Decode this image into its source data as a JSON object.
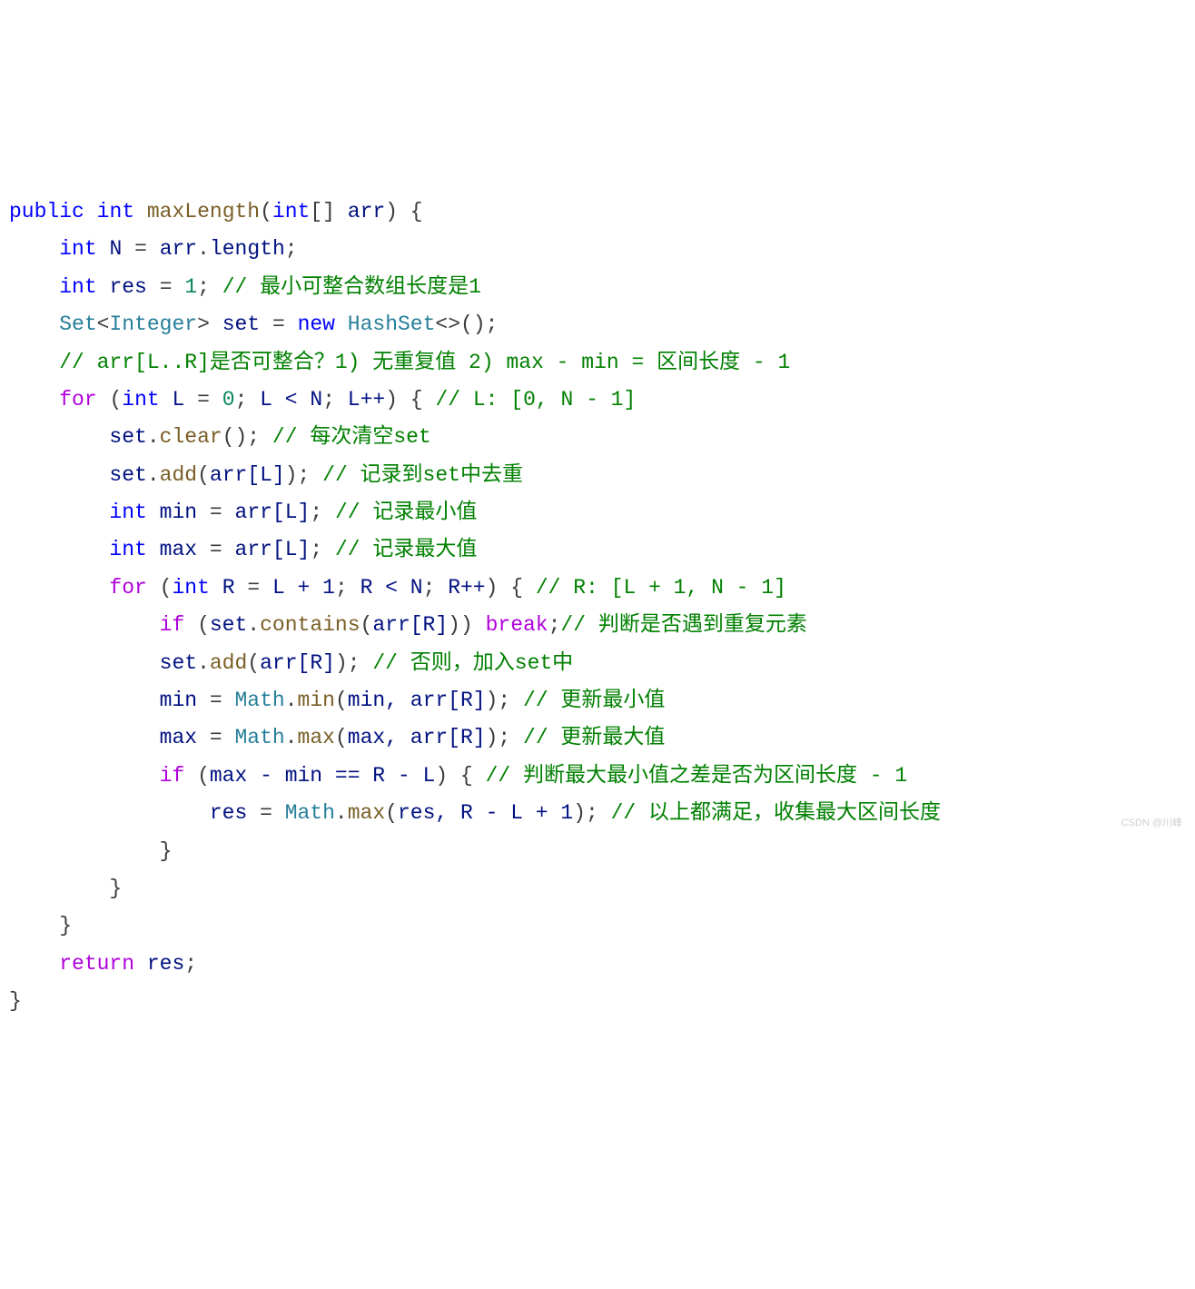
{
  "lines": {
    "l1": {
      "kw1": "public",
      "kw2": "int",
      "fn": "maxLength",
      "kw3": "int",
      "param": "arr"
    },
    "l2": {
      "kw": "int",
      "v": "N",
      "rhs_v": "arr",
      "rhs_f": "length"
    },
    "l3": {
      "kw": "int",
      "v": "res",
      "num": "1",
      "cmt": "// 最小可整合数组长度是1"
    },
    "l4": {
      "t1": "Set",
      "t2": "Integer",
      "v": "set",
      "kw": "new",
      "t3": "HashSet"
    },
    "l5": {
      "cmt": "// arr[L..R]是否可整合？1) 无重复值 2) max - min = 区间长度 - 1"
    },
    "l6": {
      "ctrl": "for",
      "kw": "int",
      "v": "L",
      "n0": "0",
      "cond": "L < N",
      "inc": "L++",
      "cmt": "// L: [0, N - 1]"
    },
    "l7": {
      "obj": "set",
      "m": "clear",
      "cmt": "// 每次清空set"
    },
    "l8": {
      "obj": "set",
      "m": "add",
      "arg": "arr[L]",
      "cmt": "// 记录到set中去重"
    },
    "l9": {
      "kw": "int",
      "v": "min",
      "rhs": "arr[L]",
      "cmt": "// 记录最小值"
    },
    "l10": {
      "kw": "int",
      "v": "max",
      "rhs": "arr[L]",
      "cmt": "// 记录最大值"
    },
    "l11": {
      "ctrl": "for",
      "kw": "int",
      "v": "R",
      "init": "L + 1",
      "cond": "R < N",
      "inc": "R++",
      "cmt": "// R: [L + 1, N - 1]"
    },
    "l12": {
      "ctrl": "if",
      "obj": "set",
      "m": "contains",
      "arg": "arr[R]",
      "brk": "break",
      "cmt": "// 判断是否遇到重复元素"
    },
    "l13": {
      "obj": "set",
      "m": "add",
      "arg": "arr[R]",
      "cmt": "// 否则，加入set中"
    },
    "l14": {
      "lhs": "min",
      "cls": "Math",
      "m": "min",
      "args": "min, arr[R]",
      "cmt": "// 更新最小值"
    },
    "l15": {
      "lhs": "max",
      "cls": "Math",
      "m": "max",
      "args": "max, arr[R]",
      "cmt": "// 更新最大值"
    },
    "l16": {
      "ctrl": "if",
      "cond": "max - min == R - L",
      "cmt": "// 判断最大最小值之差是否为区间长度 - 1"
    },
    "l17": {
      "lhs": "res",
      "cls": "Math",
      "m": "max",
      "args": "res, R - L + 1",
      "cmt": "// 以上都满足，收集最大区间长度"
    },
    "l18": {
      "brace": "}"
    },
    "l19": {
      "brace": "}"
    },
    "l20": {
      "brace": "}"
    },
    "l21": {
      "ctrl": "return",
      "v": "res"
    },
    "l22": {
      "brace": "}"
    }
  },
  "watermark": "CSDN @川峰"
}
